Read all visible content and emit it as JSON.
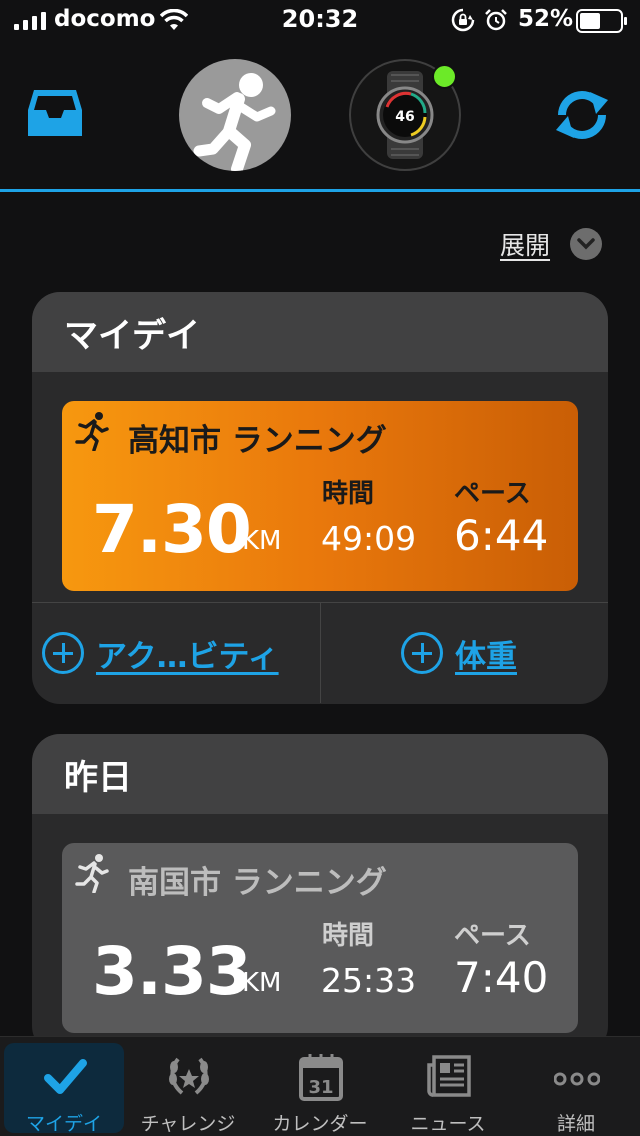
{
  "status_bar": {
    "carrier": "docomo",
    "time": "20:32",
    "battery_percent": "52%",
    "battery_level": 0.52
  },
  "header": {
    "inbox_icon": "inbox-tray-icon",
    "avatar_icon": "running-person-icon",
    "device_icon": "watch-icon",
    "device_watch_face_number": "46",
    "device_status": "connected",
    "sync_icon": "sync-icon"
  },
  "expand": {
    "label": "展開",
    "icon": "chevron-down-icon"
  },
  "my_day": {
    "title": "マイデイ",
    "activity": {
      "title": "高知市 ランニング",
      "distance": "7.30",
      "unit": "KM",
      "time_label": "時間",
      "time": "49:09",
      "pace_label": "ペース",
      "pace": "6:44"
    },
    "actions": [
      {
        "label": "アク…ビティ",
        "icon": "plus-circle-icon"
      },
      {
        "label": "体重",
        "icon": "plus-circle-icon"
      }
    ]
  },
  "yesterday": {
    "title": "昨日",
    "activity": {
      "title": "南国市 ランニング",
      "distance": "3.33",
      "unit": "KM",
      "time_label": "時間",
      "time": "25:33",
      "pace_label": "ペース",
      "pace": "7:40"
    }
  },
  "tabs": [
    {
      "label": "マイデイ",
      "icon": "checkmark-icon",
      "active": true
    },
    {
      "label": "チャレンジ",
      "icon": "laurel-icon",
      "active": false
    },
    {
      "label": "カレンダー",
      "icon": "calendar-icon",
      "calendar_day": "31",
      "active": false
    },
    {
      "label": "ニュース",
      "icon": "newspaper-icon",
      "active": false
    },
    {
      "label": "詳細",
      "icon": "more-dots-icon",
      "active": false
    }
  ],
  "colors": {
    "accent": "#1ea3e6",
    "orange_card": "#f08a0c",
    "gray_card": "#5a5a5b",
    "device_status": "#6cea28",
    "background": "#111112"
  }
}
